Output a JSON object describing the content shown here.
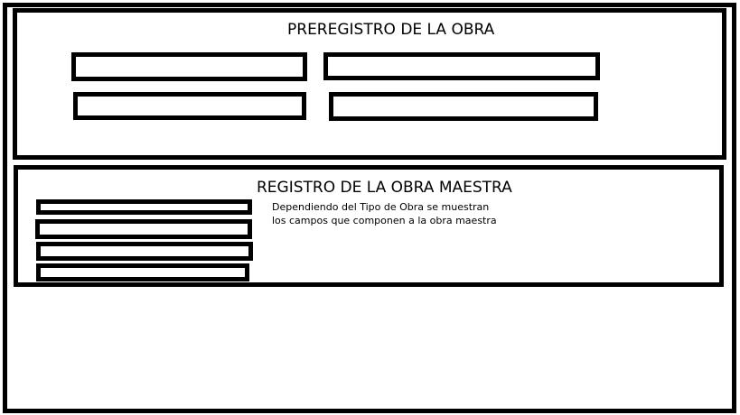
{
  "preregistro": {
    "title": "PREREGISTRO DE LA OBRA"
  },
  "registro_maestra": {
    "title": "REGISTRO DE LA OBRA MAESTRA",
    "note_line1": "Dependiendo del Tipo de Obra se muestran",
    "note_line2": "los campos que componen a la obra maestra"
  }
}
